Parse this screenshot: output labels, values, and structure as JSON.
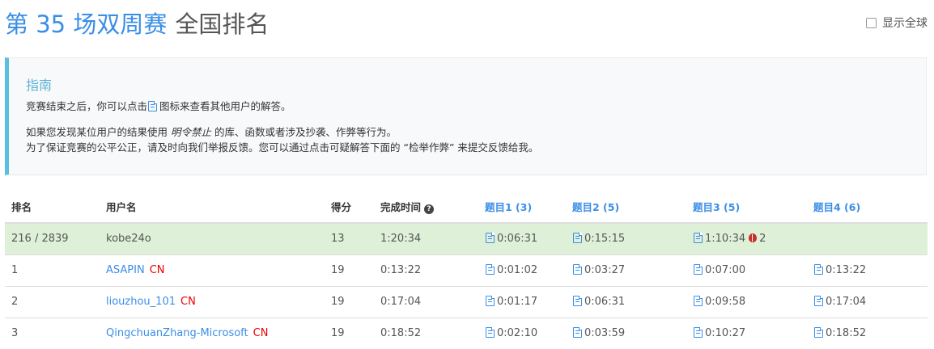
{
  "header": {
    "contest": "第 35 场双周赛",
    "suffix": "全国排名"
  },
  "global_toggle": {
    "label": "显示全球"
  },
  "guide": {
    "title": "指南",
    "line1_pre": "竞赛结束之后，你可以点击",
    "line1_post": "图标来查看其他用户的解答。",
    "line2_pre": "如果您发现某位用户的结果使用",
    "line2_em": "明令禁止",
    "line2_post": "的库、函数或者涉及抄袭、作弊等行为。",
    "line3": "为了保证竞赛的公平公正，请及时向我们举报反馈。您可以通过点击可疑解答下面的 “检举作弊” 来提交反馈给我。"
  },
  "table": {
    "headers": {
      "rank": "排名",
      "user": "用户名",
      "score": "得分",
      "time": "完成时间",
      "p1": "题目1 (3)",
      "p2": "题目2 (5)",
      "p3": "题目3 (5)",
      "p4": "题目4 (6)"
    },
    "me": {
      "rank": "216 / 2839",
      "user": "kobe24o",
      "score": "13",
      "time": "1:20:34",
      "p1": "0:06:31",
      "p2": "0:15:15",
      "p3": "1:10:34",
      "p3_bugs": "2",
      "p4": ""
    },
    "rows": [
      {
        "rank": "1",
        "user": "ASAPIN",
        "region": "CN",
        "score": "19",
        "time": "0:13:22",
        "p1": "0:01:02",
        "p2": "0:03:27",
        "p3": "0:07:00",
        "p4": "0:13:22"
      },
      {
        "rank": "2",
        "user": "liouzhou_101",
        "region": "CN",
        "score": "19",
        "time": "0:17:04",
        "p1": "0:01:17",
        "p2": "0:06:31",
        "p3": "0:09:58",
        "p4": "0:17:04"
      },
      {
        "rank": "3",
        "user": "QingchuanZhang-Microsoft",
        "region": "CN",
        "score": "19",
        "time": "0:18:52",
        "p1": "0:02:10",
        "p2": "0:03:59",
        "p3": "0:10:27",
        "p4": "0:18:52"
      }
    ]
  }
}
